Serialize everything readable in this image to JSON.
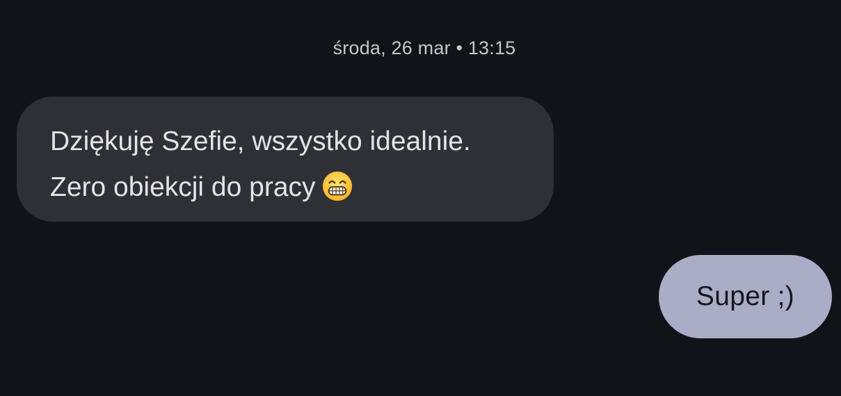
{
  "conversation": {
    "timestamp": "środa, 26 mar • 13:15",
    "incoming": {
      "line1": "Dziękuję Szefie, wszystko idealnie.",
      "line2": "Zero obiekcji do pracy",
      "emoji": "grinning-face-with-smiling-eyes-icon"
    },
    "outgoing": {
      "text": "Super ;)"
    }
  },
  "colors": {
    "background": "#121318",
    "incoming_bubble": "#2f3036",
    "outgoing_bubble": "#a9adc6",
    "timestamp_text": "#c4c6cf"
  }
}
